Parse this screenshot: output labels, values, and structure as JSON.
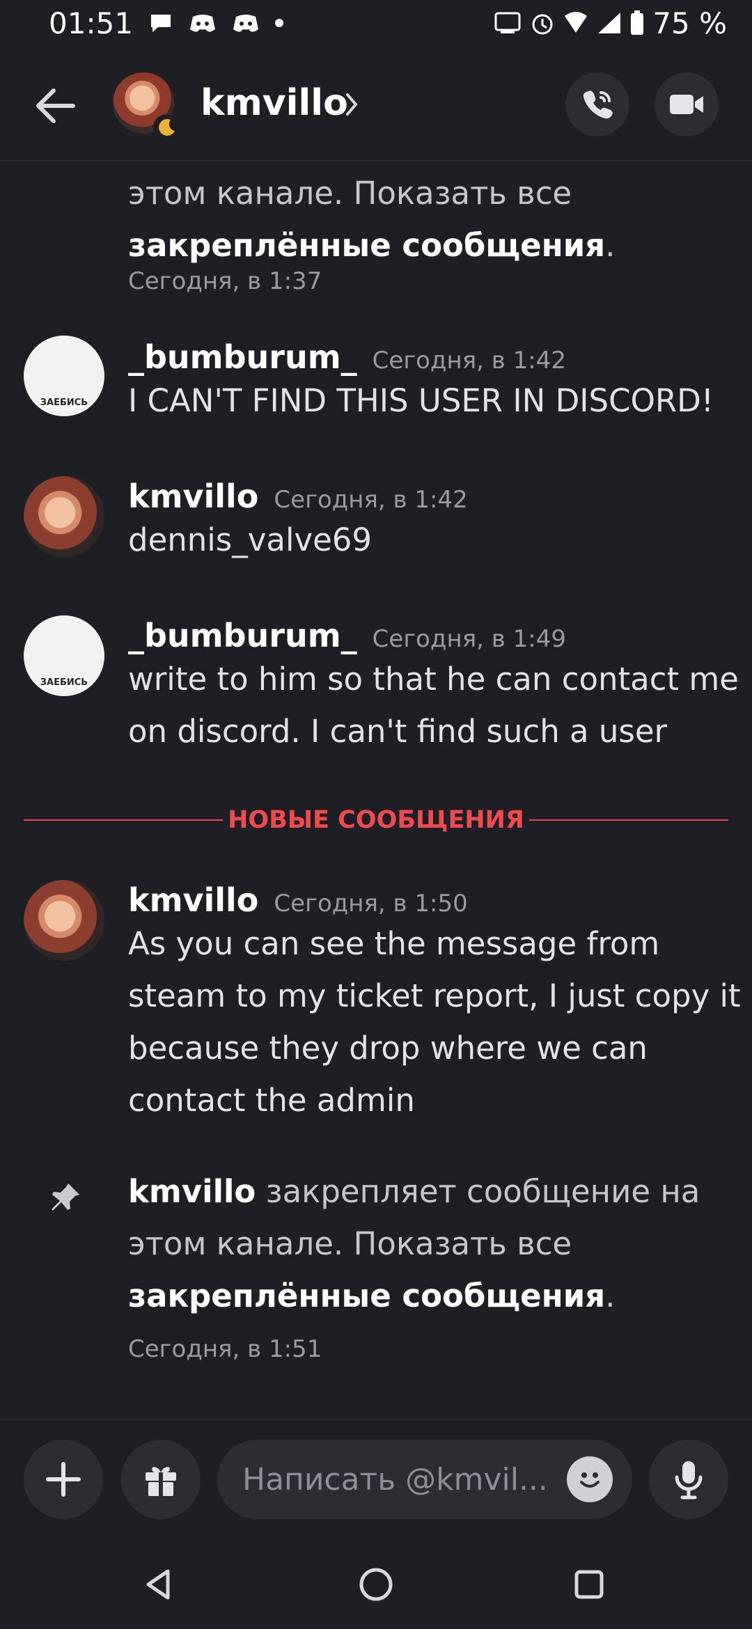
{
  "status_bar": {
    "time": "01:51",
    "battery": "75 %"
  },
  "header": {
    "title": "kmvillo"
  },
  "messages": {
    "pinned_top": {
      "line1": "этом канале. Показать все",
      "bold": "закреплённые сообщения",
      "period": ".",
      "time": "Сегодня, в 1:37"
    },
    "m1": {
      "author": "_bumburum_",
      "time": "Сегодня, в 1:42",
      "text": "I CAN'T FIND THIS USER IN DISCORD!",
      "avatar_tag": "ЗАЕБИСЬ"
    },
    "m2": {
      "author": "kmvillo",
      "time": "Сегодня, в 1:42",
      "text": "dennis_valve69"
    },
    "m3": {
      "author": "_bumburum_",
      "time": "Сегодня, в 1:49",
      "text": "write to him so that he can contact me on discord. I can't find such a user",
      "avatar_tag": "ЗАЕБИСЬ"
    },
    "divider": "НОВЫЕ СООБЩЕНИЯ",
    "m4": {
      "author": "kmvillo",
      "time": "Сегодня, в 1:50",
      "text": "As you can see the message from steam to my ticket report, I just copy it because they drop where we can contact the admin"
    },
    "pinned_bottom": {
      "author": "kmvillo",
      "action": " закрепляет сообщение на этом канале. Показать все ",
      "bold": "закреплённые сообщения",
      "period": ".",
      "time": "Сегодня, в 1:51"
    }
  },
  "composer": {
    "placeholder": "Написать @kmvil..."
  },
  "colors": {
    "background": "#1e1f24",
    "accent_red": "#f04a4f",
    "surface": "#2b2d33"
  },
  "icons": [
    "back-arrow-icon",
    "chevron-right-icon",
    "phone-icon",
    "video-camera-icon",
    "plus-icon",
    "gift-icon",
    "emoji-icon",
    "microphone-icon",
    "pin-icon",
    "moon-icon"
  ]
}
